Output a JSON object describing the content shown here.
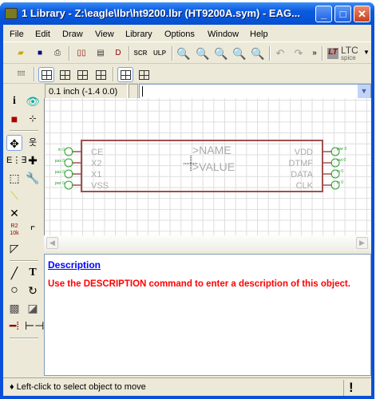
{
  "window": {
    "title": "1 Library - Z:\\eagle\\lbr\\ht9200.lbr (HT9200A.sym) - EAG...",
    "minimize": "_",
    "maximize": "□",
    "close": "✕"
  },
  "menu": [
    "File",
    "Edit",
    "Draw",
    "View",
    "Library",
    "Options",
    "Window",
    "Help"
  ],
  "toolbar": {
    "icons": [
      "open-icon",
      "save-icon",
      "print-icon",
      "schematic-icon",
      "board-icon",
      "symbol-icon",
      "script-icon",
      "ulp-icon",
      "zoom-fit-icon",
      "zoom-in-icon",
      "zoom-out-icon",
      "zoom-redraw-icon",
      "zoom-select-icon",
      "undo-icon",
      "redo-icon",
      "more-icon"
    ],
    "script_label": "SCR",
    "ulp_label": "ULP",
    "more": "»",
    "ltc": "LTC",
    "spice": "spice"
  },
  "coord": {
    "value": "0.1 inch (-1.4 0.0)"
  },
  "command": {
    "value": ""
  },
  "symbol": {
    "left_pins": [
      {
        "name": "CE",
        "dir": "in 0"
      },
      {
        "name": "X2",
        "dir": "pas 0"
      },
      {
        "name": "X1",
        "dir": "pas 0"
      },
      {
        "name": "VSS",
        "dir": "pwr 0"
      }
    ],
    "right_pins": [
      {
        "name": "VDD",
        "dir": "pwr 0"
      },
      {
        "name": "DTMF",
        "dir": "out 0"
      },
      {
        "name": "DATA",
        "dir": "io 0"
      },
      {
        "name": "CLK",
        "dir": "io 0"
      }
    ],
    "name_label": ">NAME",
    "value_label": ">VALUE",
    "outline_color": "#a05050",
    "pin_color": "#2ca02c"
  },
  "description": {
    "heading": "Description",
    "message": "Use the DESCRIPTION command to enter a description of this object."
  },
  "status": {
    "text": "Left-click to select object to move",
    "indicator": "!"
  }
}
